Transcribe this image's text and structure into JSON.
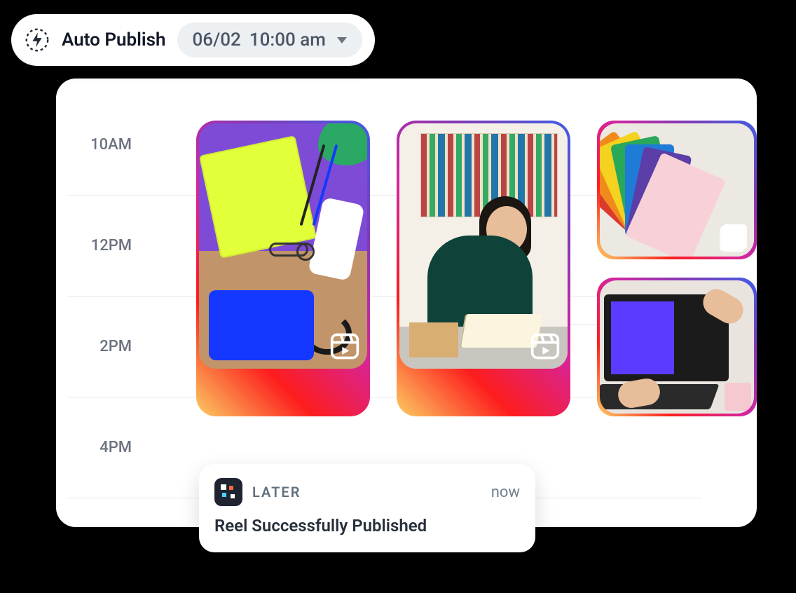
{
  "publish": {
    "label": "Auto Publish",
    "date": "06/02",
    "time": "10:00 am"
  },
  "timeline": {
    "labels": [
      "10AM",
      "12PM",
      "2PM",
      "4PM"
    ]
  },
  "posts": {
    "left": {
      "type": "reel"
    },
    "mid": {
      "type": "reel"
    },
    "right_top": {
      "type": "carousel"
    },
    "right_bottom": {
      "type": "image"
    }
  },
  "toast": {
    "app": "LATER",
    "when": "now",
    "message": "Reel Successfully Published"
  }
}
